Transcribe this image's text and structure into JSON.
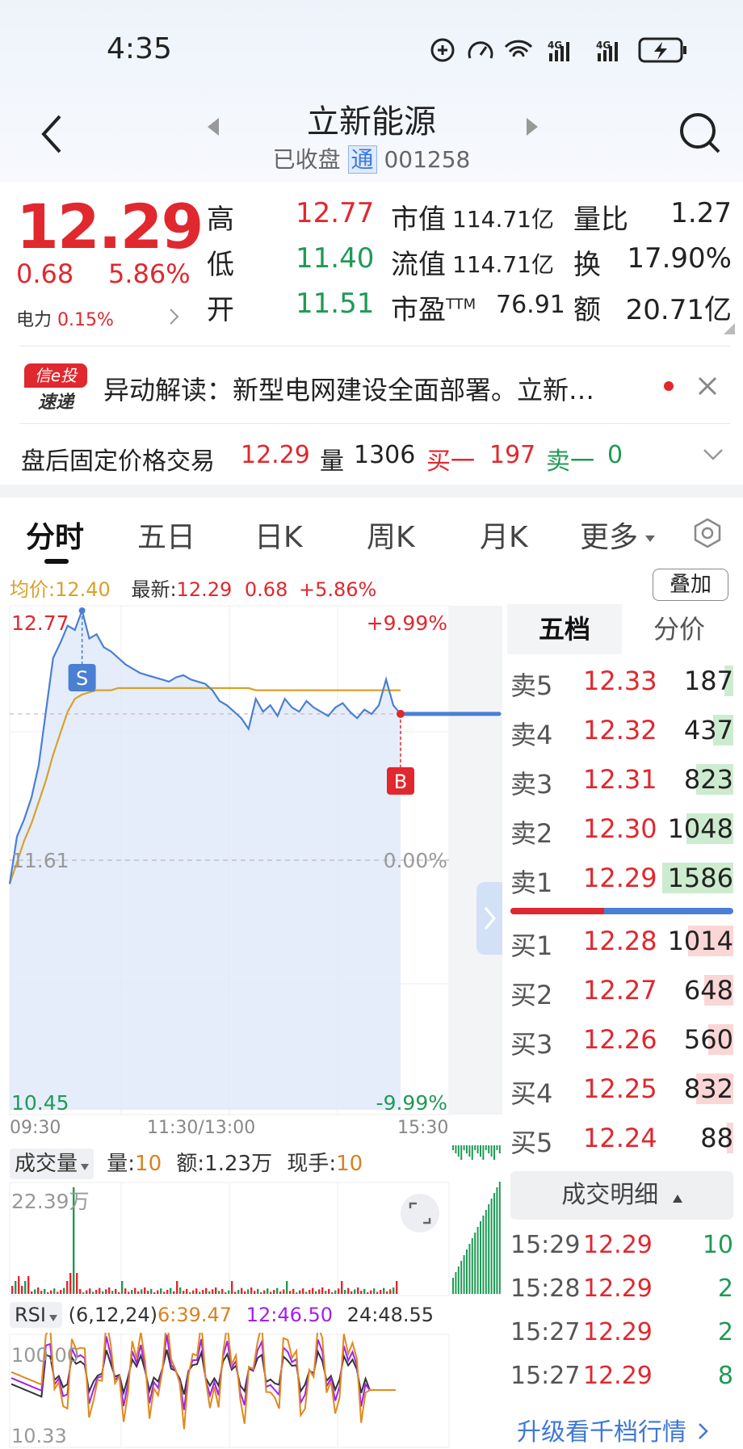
{
  "status_bar": {
    "time": "4:35"
  },
  "header": {
    "title": "立新能源",
    "status": "已收盘",
    "tong_badge": "通",
    "code": "001258"
  },
  "quote": {
    "price": "12.29",
    "change": "0.68",
    "change_pct": "5.86%",
    "sector_name": "电力",
    "sector_pct": "0.15%",
    "high_label": "高",
    "high": "12.77",
    "low_label": "低",
    "low": "11.40",
    "open_label": "开",
    "open": "11.51",
    "mktcap_label": "市值",
    "mktcap": "114.71亿",
    "float_label": "流值",
    "float": "114.71亿",
    "pe_label": "市盈",
    "pe_sup": "TTM",
    "pe": "76.91",
    "volratio_label": "量比",
    "volratio": "1.27",
    "turnover_label": "换",
    "turnover": "17.90%",
    "amount_label": "额",
    "amount": "20.71亿"
  },
  "news": {
    "logo_top": "信e投",
    "logo_bottom": "速递",
    "text": "异动解读：新型电网建设全面部署。立新…"
  },
  "after_hours": {
    "label": "盘后固定价格交易",
    "price": "12.29",
    "vol_label": "量",
    "vol": "1306",
    "buy_label": "买一",
    "buy": "197",
    "sell_label": "卖一",
    "sell": "0"
  },
  "tabs": [
    "分时",
    "五日",
    "日K",
    "周K",
    "月K",
    "更多"
  ],
  "chart_info": {
    "avg_label": "均价:",
    "avg": "12.40",
    "latest_label": "最新:",
    "latest": "12.29",
    "change": "0.68",
    "change_pct": "+5.86%",
    "overlay_button": "叠加"
  },
  "chart_data": {
    "type": "line",
    "title": "",
    "ylim": [
      10.45,
      12.77
    ],
    "y_left_ticks": [
      "12.77",
      "11.61",
      "10.45"
    ],
    "y_right_ticks": [
      "+9.99%",
      "0.00%",
      "-9.99%"
    ],
    "x_ticks": [
      "09:30",
      "11:30/13:00",
      "15:30"
    ],
    "prev_close": 11.61,
    "marker_s": "S",
    "marker_b": "B",
    "series": [
      {
        "values": [
          11.5,
          11.72,
          11.8,
          11.9,
          12.05,
          12.3,
          12.55,
          12.62,
          12.7,
          12.68,
          12.77,
          12.64,
          12.66,
          12.6,
          12.58,
          12.55,
          12.52,
          12.5,
          12.48,
          12.47,
          12.46,
          12.45,
          12.44,
          12.46,
          12.47,
          12.45,
          12.44,
          12.43,
          12.4,
          12.35,
          12.33,
          12.3,
          12.27,
          12.22,
          12.36,
          12.3,
          12.33,
          12.28,
          12.36,
          12.32,
          12.3,
          12.35,
          12.32,
          12.3,
          12.28,
          12.32,
          12.34,
          12.3,
          12.27,
          12.31,
          12.29,
          12.33,
          12.45,
          12.33,
          12.29
        ]
      },
      {
        "values": [
          11.5,
          11.6,
          11.7,
          11.78,
          11.88,
          11.98,
          12.1,
          12.2,
          12.3,
          12.36,
          12.38,
          12.39,
          12.4,
          12.4,
          12.4,
          12.41,
          12.41,
          12.41,
          12.41,
          12.41,
          12.41,
          12.41,
          12.41,
          12.41,
          12.41,
          12.41,
          12.41,
          12.41,
          12.41,
          12.41,
          12.41,
          12.41,
          12.41,
          12.41,
          12.4,
          12.4,
          12.4,
          12.4,
          12.4,
          12.4,
          12.4,
          12.4,
          12.4,
          12.4,
          12.4,
          12.4,
          12.4,
          12.4,
          12.4,
          12.4,
          12.4,
          12.4,
          12.4,
          12.4,
          12.4
        ]
      }
    ]
  },
  "order_book": {
    "tab_active": "五档",
    "tab_other": "分价",
    "asks": [
      {
        "label": "卖5",
        "price": "12.33",
        "vol": "187",
        "ratio": 0.12
      },
      {
        "label": "卖4",
        "price": "12.32",
        "vol": "437",
        "ratio": 0.28
      },
      {
        "label": "卖3",
        "price": "12.31",
        "vol": "823",
        "ratio": 0.52
      },
      {
        "label": "卖2",
        "price": "12.30",
        "vol": "1048",
        "ratio": 0.66
      },
      {
        "label": "卖1",
        "price": "12.29",
        "vol": "1586",
        "ratio": 1.0
      }
    ],
    "bids": [
      {
        "label": "买1",
        "price": "12.28",
        "vol": "1014",
        "ratio": 0.64
      },
      {
        "label": "买2",
        "price": "12.27",
        "vol": "648",
        "ratio": 0.41
      },
      {
        "label": "买3",
        "price": "12.26",
        "vol": "560",
        "ratio": 0.35
      },
      {
        "label": "买4",
        "price": "12.25",
        "vol": "832",
        "ratio": 0.52
      },
      {
        "label": "买5",
        "price": "12.24",
        "vol": "88",
        "ratio": 0.06
      }
    ],
    "bid_ask_ratio": 0.42
  },
  "trades": {
    "header": "成交明细",
    "rows": [
      {
        "time": "15:29",
        "price": "12.29",
        "vol": "10"
      },
      {
        "time": "15:28",
        "price": "12.29",
        "vol": "2"
      },
      {
        "time": "15:27",
        "price": "12.29",
        "vol": "2"
      },
      {
        "time": "15:27",
        "price": "12.29",
        "vol": "8"
      }
    ],
    "upgrade": "升级看千档行情"
  },
  "volume_panel": {
    "selector": "成交量",
    "vol_label": "量:",
    "vol": "10",
    "amt_label": "额:",
    "amt": "1.23万",
    "hand_label": "现手:",
    "hand": "10",
    "max_label": "22.39万"
  },
  "rsi_panel": {
    "selector": "RSI",
    "params": "(6,12,24)",
    "rsi6": "6:39.47",
    "rsi12": "12:46.50",
    "rsi24": "24:48.55",
    "top_label": "100.00",
    "bottom_label": "10.33"
  },
  "colors": {
    "red": "#e0282e",
    "green": "#1f9a55",
    "blue": "#4a7fd4",
    "gold": "#d9a12a",
    "purple": "#a020f0"
  }
}
